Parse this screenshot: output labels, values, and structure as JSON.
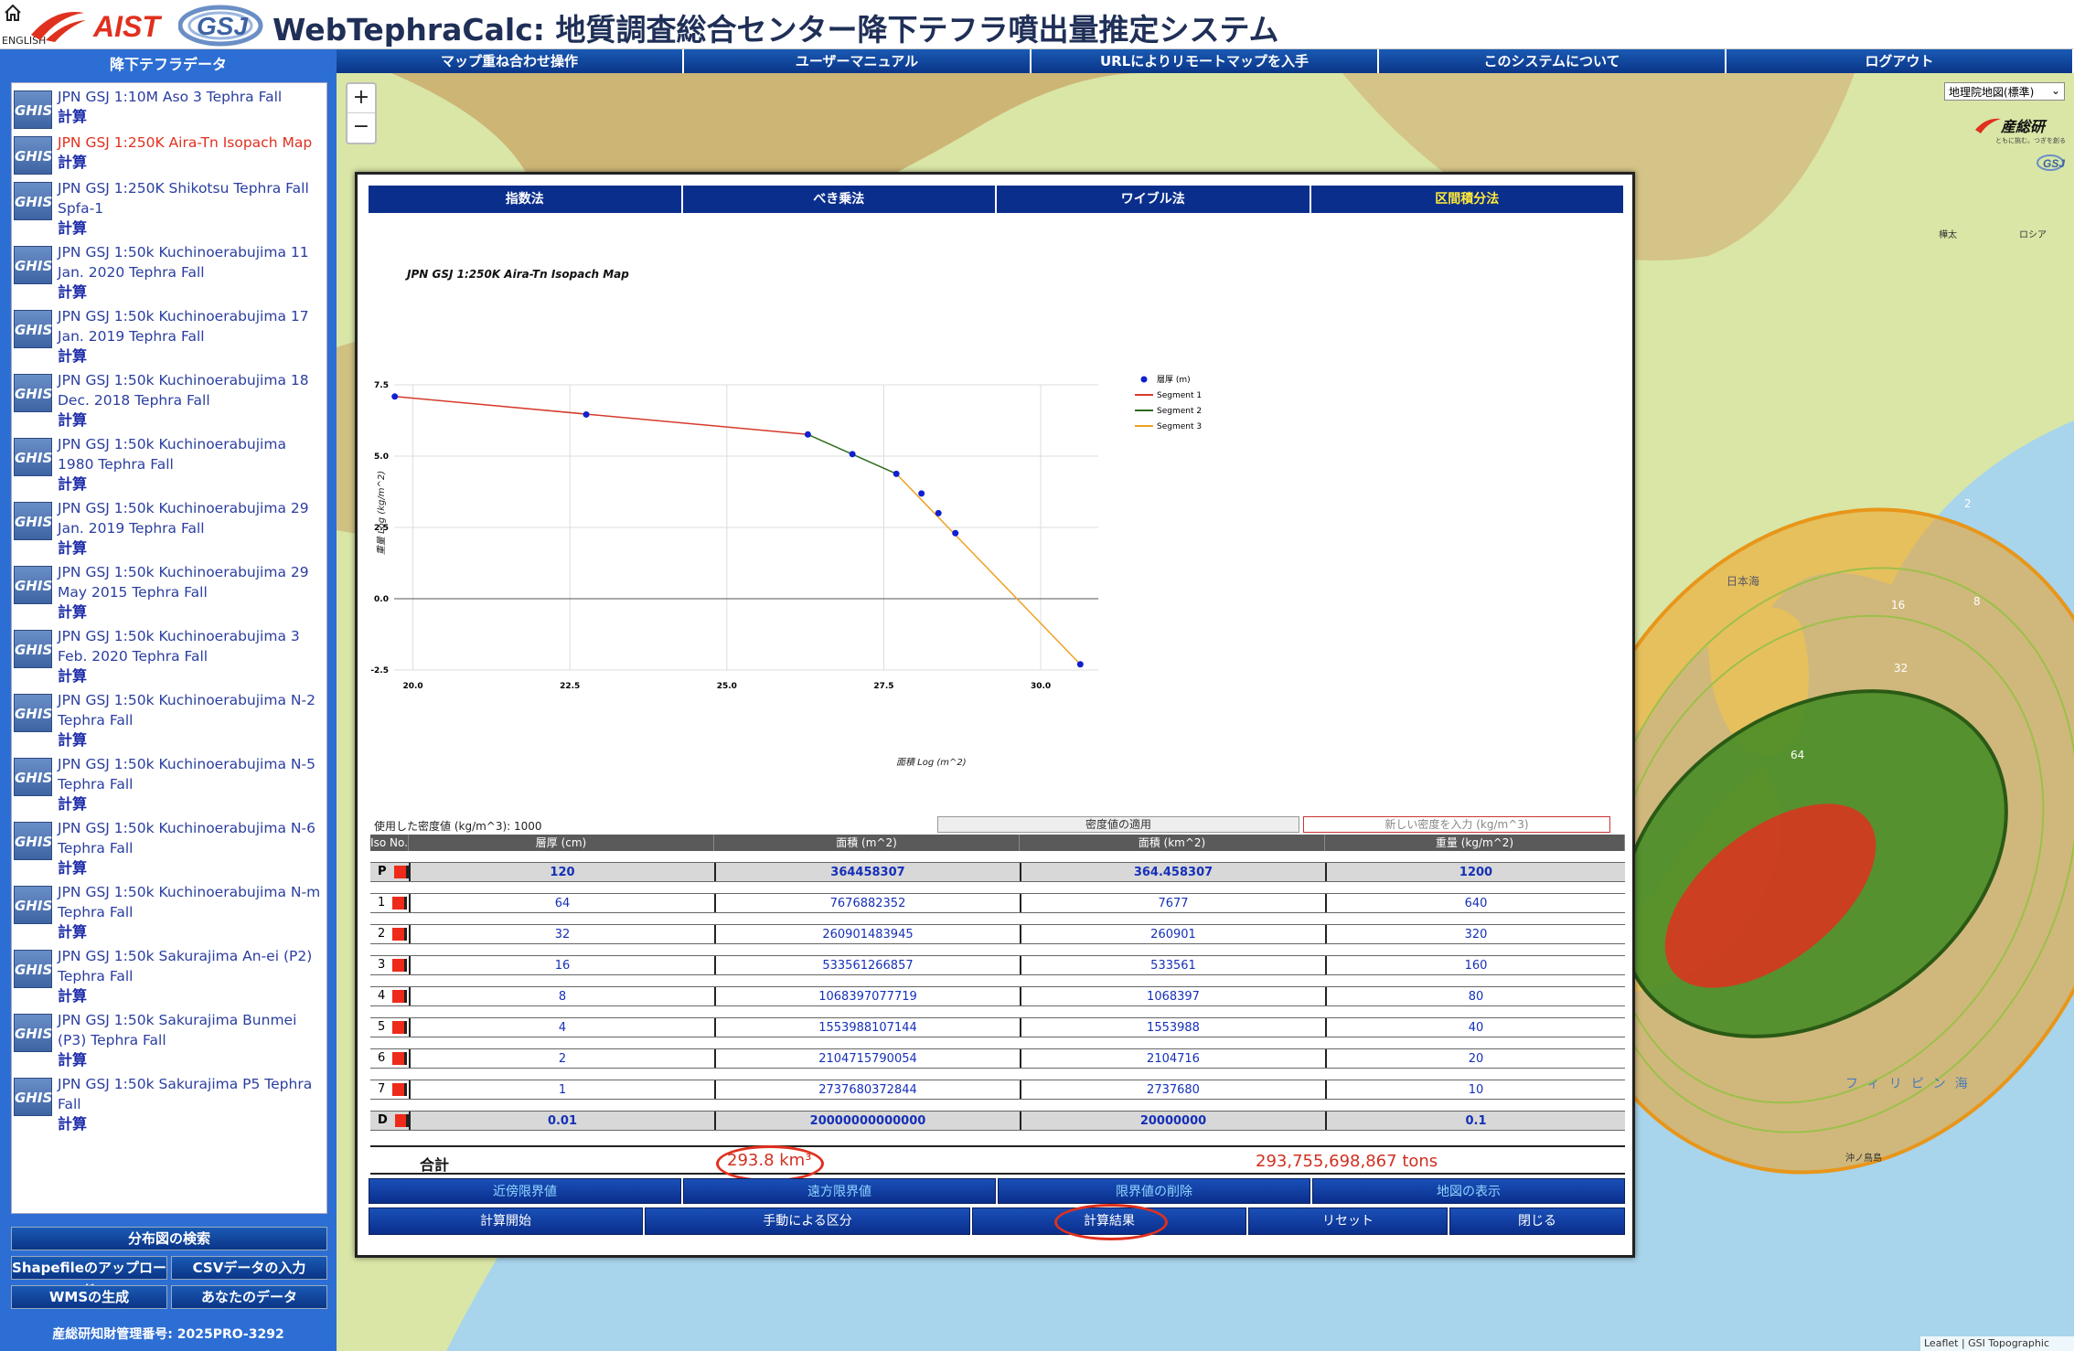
{
  "header": {
    "english_label": "ENGLISH",
    "aist_logo_text": "AIST",
    "gsj_logo_text": "GSJ",
    "title": "WebTephraCalc: 地質調査総合センター降下テフラ噴出量推定システム"
  },
  "topnav": {
    "items": [
      "マップ重ね合わせ操作",
      "ユーザーマニュアル",
      "URLによりリモートマップを入手",
      "このシステムについて",
      "ログアウト"
    ]
  },
  "sidebar": {
    "title": "降下テフラデータ",
    "icon_label": "GHIS",
    "calc_label": "計算",
    "datasets": [
      {
        "name": "JPN GSJ 1:10M Aso 3 Tephra Fall",
        "active": false
      },
      {
        "name": "JPN GSJ 1:250K Aira-Tn Isopach Map",
        "active": true
      },
      {
        "name": "JPN GSJ 1:250K Shikotsu Tephra Fall Spfa-1",
        "active": false
      },
      {
        "name": "JPN GSJ 1:50k Kuchinoerabujima 11 Jan. 2020 Tephra Fall",
        "active": false
      },
      {
        "name": "JPN GSJ 1:50k Kuchinoerabujima 17 Jan. 2019 Tephra Fall",
        "active": false
      },
      {
        "name": "JPN GSJ 1:50k Kuchinoerabujima 18 Dec. 2018 Tephra Fall",
        "active": false
      },
      {
        "name": "JPN GSJ 1:50k Kuchinoerabujima 1980 Tephra Fall",
        "active": false
      },
      {
        "name": "JPN GSJ 1:50k Kuchinoerabujima 29 Jan. 2019 Tephra Fall",
        "active": false
      },
      {
        "name": "JPN GSJ 1:50k Kuchinoerabujima 29 May 2015 Tephra Fall",
        "active": false
      },
      {
        "name": "JPN GSJ 1:50k Kuchinoerabujima 3 Feb. 2020 Tephra Fall",
        "active": false
      },
      {
        "name": "JPN GSJ 1:50k Kuchinoerabujima N-2 Tephra Fall",
        "active": false
      },
      {
        "name": "JPN GSJ 1:50k Kuchinoerabujima N-5 Tephra Fall",
        "active": false
      },
      {
        "name": "JPN GSJ 1:50k Kuchinoerabujima N-6 Tephra Fall",
        "active": false
      },
      {
        "name": "JPN GSJ 1:50k Kuchinoerabujima N-m Tephra Fall",
        "active": false
      },
      {
        "name": "JPN GSJ 1:50k Sakurajima An-ei (P2) Tephra Fall",
        "active": false
      },
      {
        "name": "JPN GSJ 1:50k Sakurajima Bunmei (P3) Tephra Fall",
        "active": false
      },
      {
        "name": "JPN GSJ 1:50k Sakurajima P5 Tephra Fall",
        "active": false
      }
    ],
    "search_button": "分布図の検索",
    "upload_shapefile": "Shapefileのアップロード",
    "csv_input": "CSVデータの入力",
    "wms_generate": "WMSの生成",
    "your_data": "あなたのデータ",
    "ip_number": "産総研知財管理番号: 2025PRO-3292"
  },
  "map": {
    "basemap_selected": "地理院地図(標準)",
    "brand_text": "産総研",
    "brand_sub": "ともに挑む。つぎを創る。",
    "zoom_in": "+",
    "zoom_out": "−",
    "attribution": "Leaflet | GSI Topographic Map",
    "isopach_labels": [
      "2",
      "16",
      "8",
      "32",
      "64"
    ],
    "place_labels": [
      "日本海",
      "フィリピン海",
      "沖ノ鳥島",
      "樺太",
      "ロシア"
    ]
  },
  "panel": {
    "tabs": [
      "指数法",
      "べき乗法",
      "ワイブル法",
      "区間積分法"
    ],
    "density_used": "使用した密度値 (kg/m^3): 1000",
    "density_apply": "密度値の適用",
    "density_placeholder": "新しい密度を入力 (kg/m^3)",
    "table": {
      "headers": [
        "Iso No.",
        "層厚 (cm)",
        "面積 (m^2)",
        "面積 (km^2)",
        "重量 (kg/m^2)"
      ],
      "rows": [
        {
          "iso": "P",
          "thickness": "120",
          "area_m2": "364458307",
          "area_km2": "364.458307",
          "mass": "1200"
        },
        {
          "iso": "1",
          "thickness": "64",
          "area_m2": "7676882352",
          "area_km2": "7677",
          "mass": "640"
        },
        {
          "iso": "2",
          "thickness": "32",
          "area_m2": "260901483945",
          "area_km2": "260901",
          "mass": "320"
        },
        {
          "iso": "3",
          "thickness": "16",
          "area_m2": "533561266857",
          "area_km2": "533561",
          "mass": "160"
        },
        {
          "iso": "4",
          "thickness": "8",
          "area_m2": "1068397077719",
          "area_km2": "1068397",
          "mass": "80"
        },
        {
          "iso": "5",
          "thickness": "4",
          "area_m2": "1553988107144",
          "area_km2": "1553988",
          "mass": "40"
        },
        {
          "iso": "6",
          "thickness": "2",
          "area_m2": "2104715790054",
          "area_km2": "2104716",
          "mass": "20"
        },
        {
          "iso": "7",
          "thickness": "1",
          "area_m2": "2737680372844",
          "area_km2": "2737680",
          "mass": "10"
        },
        {
          "iso": "D",
          "thickness": "0.01",
          "area_m2": "20000000000000",
          "area_km2": "20000000",
          "mass": "0.1"
        }
      ]
    },
    "total_label": "合計",
    "total_volume": "293.8 km³",
    "total_mass": "293,755,698,867 tons",
    "buttons_row1": [
      "近傍限界値",
      "遠方限界値",
      "限界値の削除",
      "地図の表示"
    ],
    "buttons_row2": [
      "計算開始",
      "手動による区分",
      "計算結果",
      "リセット",
      "閉じる"
    ]
  },
  "colors": {
    "segment1": "#d63a2a",
    "segment2": "#2e6b1e",
    "segment3": "#f0a020",
    "points": "#1020d0",
    "nav_blue": "#0a3c8c"
  },
  "chart_data": {
    "type": "line",
    "title": "JPN GSJ 1:250K Aira-Tn Isopach Map",
    "xlabel": "面積 Log (m^2)",
    "ylabel": "重量 Log (kg/m^2)",
    "xlim": [
      19.7,
      30.8
    ],
    "ylim": [
      -2.5,
      7.5
    ],
    "xticks": [
      "20.0",
      "22.5",
      "25.0",
      "27.5",
      "30.0"
    ],
    "yticks": [
      "7.5",
      "5.0",
      "2.5",
      "0.0",
      "-2.5"
    ],
    "grid": true,
    "legend_position": "top-right",
    "points_name": "層厚 (m)",
    "points": [
      {
        "x": 19.71,
        "y": 7.09
      },
      {
        "x": 22.76,
        "y": 6.46
      },
      {
        "x": 26.29,
        "y": 5.76
      },
      {
        "x": 27.0,
        "y": 5.07
      },
      {
        "x": 27.7,
        "y": 4.38
      },
      {
        "x": 28.1,
        "y": 3.69
      },
      {
        "x": 28.37,
        "y": 3.0
      },
      {
        "x": 28.64,
        "y": 2.3
      },
      {
        "x": 30.63,
        "y": -2.3
      }
    ],
    "series": [
      {
        "name": "Segment 1",
        "color": "#d63a2a",
        "x": [
          19.71,
          26.29
        ],
        "y": [
          7.09,
          5.76
        ]
      },
      {
        "name": "Segment 2",
        "color": "#2e6b1e",
        "x": [
          26.29,
          27.7
        ],
        "y": [
          5.76,
          4.38
        ]
      },
      {
        "name": "Segment 3",
        "color": "#f0a020",
        "x": [
          27.7,
          30.63
        ],
        "y": [
          4.38,
          -2.3
        ]
      }
    ]
  }
}
